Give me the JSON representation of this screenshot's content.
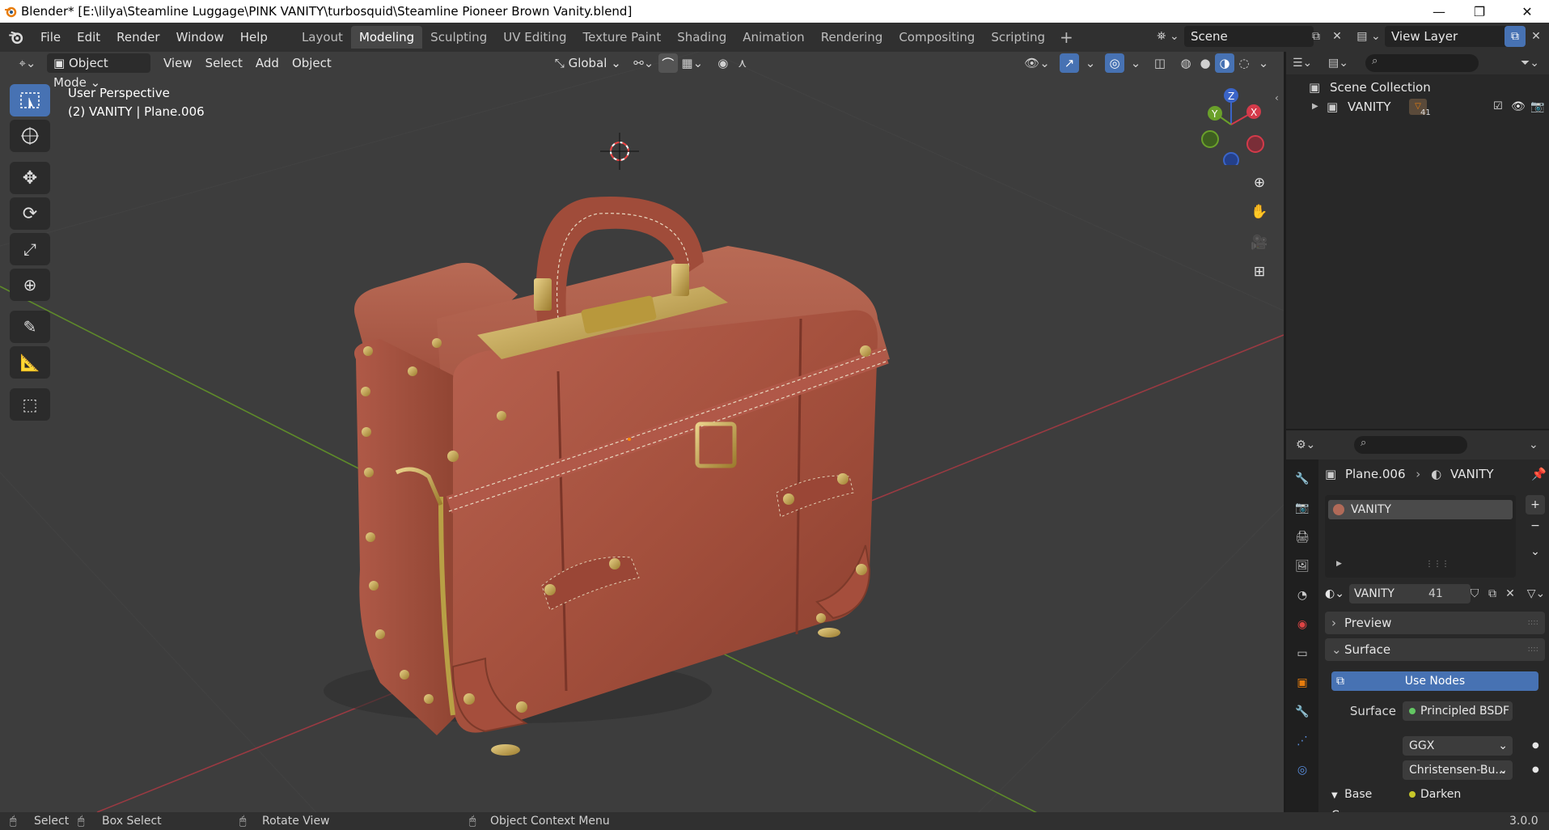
{
  "window": {
    "title": "Blender* [E:\\lilya\\Steamline Luggage\\PINK VANITY\\turbosquid\\Steamline Pioneer Brown Vanity.blend]"
  },
  "menu": [
    "File",
    "Edit",
    "Render",
    "Window",
    "Help"
  ],
  "workspaces": [
    "Layout",
    "Modeling",
    "Sculpting",
    "UV Editing",
    "Texture Paint",
    "Shading",
    "Animation",
    "Rendering",
    "Compositing",
    "Scripting"
  ],
  "active_workspace": "Modeling",
  "scene": {
    "name": "Scene",
    "view_layer": "View Layer"
  },
  "viewport": {
    "mode": "Object Mode",
    "menus": [
      "View",
      "Select",
      "Add",
      "Object"
    ],
    "orientation": "Global",
    "info_line1": "User Perspective",
    "info_line2": "(2) VANITY | Plane.006",
    "gizmo": {
      "x": "X",
      "y": "Y",
      "z": "Z"
    }
  },
  "outliner": {
    "scene_collection": "Scene Collection",
    "object_name": "VANITY",
    "material_count": "41"
  },
  "properties": {
    "breadcrumb_object": "Plane.006",
    "breadcrumb_material": "VANITY",
    "slot_name": "VANITY",
    "material_name": "VANITY",
    "user_count": "41",
    "panel_preview": "Preview",
    "panel_surface": "Surface",
    "use_nodes": "Use Nodes",
    "surface_label": "Surface",
    "surface_value": "Principled BSDF",
    "distribution": "GGX",
    "subsurface": "Christensen-Bu...",
    "base_color_label": "Base Co...",
    "base_color_value": "Darken"
  },
  "statusbar": {
    "select": "Select",
    "box_select": "Box Select",
    "rotate_view": "Rotate View",
    "context_menu": "Object Context Menu",
    "version": "3.0.0"
  },
  "colors": {
    "accent": "#4772b3",
    "viewport_bg": "#3d3d3d",
    "case_leather": "#a0503c",
    "brass": "#c8a84e"
  }
}
